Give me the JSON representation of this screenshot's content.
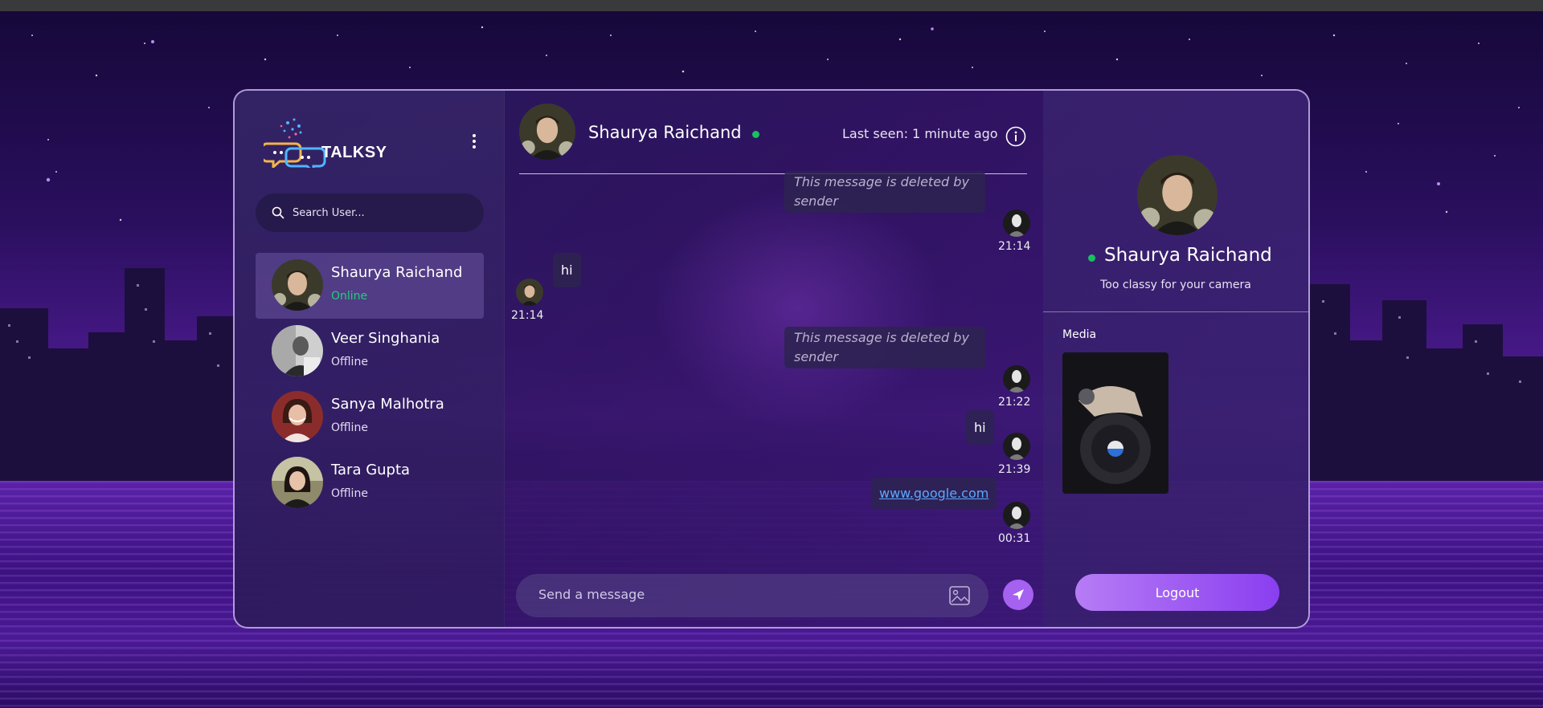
{
  "brand": {
    "name": "TALKSY"
  },
  "search": {
    "placeholder": "Search User..."
  },
  "contacts": [
    {
      "name": "Shaurya Raichand",
      "status": "Online"
    },
    {
      "name": "Veer Singhania",
      "status": "Offline"
    },
    {
      "name": "Sanya Malhotra",
      "status": "Offline"
    },
    {
      "name": "Tara Gupta",
      "status": "Offline"
    }
  ],
  "chat": {
    "contact_name": "Shaurya Raichand",
    "last_seen": "Last seen: 1 minute ago",
    "messages": [
      {
        "text": "This message is deleted by sender",
        "time": "21:14",
        "side": "right"
      },
      {
        "text": "hi",
        "time": "21:14",
        "side": "left"
      },
      {
        "text": "This message is deleted by sender",
        "time": "21:22",
        "side": "right"
      },
      {
        "text": "hi",
        "time": "21:39",
        "side": "right"
      },
      {
        "text": "www.google.com",
        "time": "00:31",
        "side": "right"
      }
    ],
    "composer_placeholder": "Send a message"
  },
  "profile": {
    "name": "Shaurya Raichand",
    "bio": "Too classy for your camera",
    "media_label": "Media",
    "logout_label": "Logout"
  },
  "colors": {
    "accent": "#a561f0",
    "online": "#18c060",
    "link": "#5aa8ff"
  }
}
